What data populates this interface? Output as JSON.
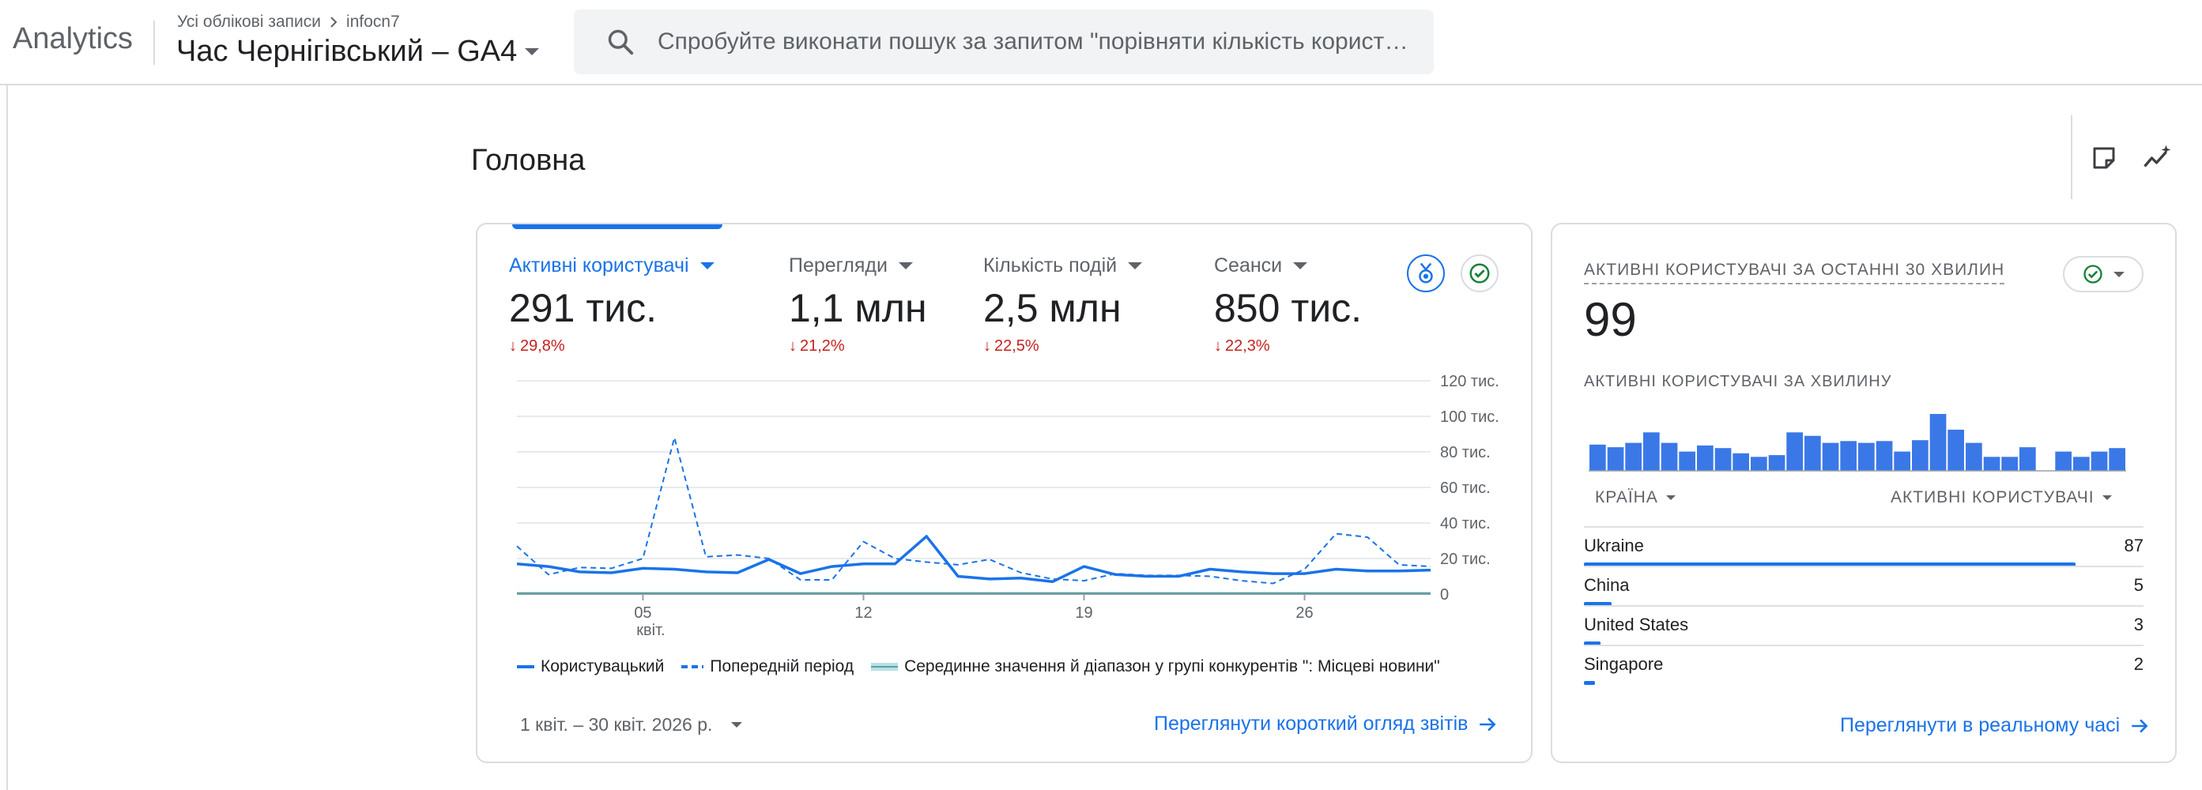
{
  "header": {
    "brand": "Analytics",
    "breadcrumb": {
      "accounts": "Усі облікові записи",
      "account": "infocn7"
    },
    "property": "Час Чернігівський – GA4",
    "search_placeholder": "Спробуйте виконати пошук за запитом \"порівняти кількість користувачів"
  },
  "page": {
    "title": "Головна"
  },
  "main_card": {
    "metrics": [
      {
        "label": "Активні користувачі",
        "value": "291 тис.",
        "change": "29,8%",
        "active": true
      },
      {
        "label": "Перегляди",
        "value": "1,1 млн",
        "change": "21,2%",
        "active": false
      },
      {
        "label": "Кількість подій",
        "value": "2,5 млн",
        "change": "22,5%",
        "active": false
      },
      {
        "label": "Сеанси",
        "value": "850 тис.",
        "change": "22,3%",
        "active": false
      }
    ],
    "legend": {
      "current": "Користувацький",
      "previous": "Попередній період",
      "benchmark": "Серединне значення й діапазон у групі конкурентів \": Місцеві новини\""
    },
    "date_range": "1 квіт. – 30 квіт. 2026 р.",
    "link": "Переглянути короткий огляд звітів"
  },
  "chart_data": {
    "type": "line",
    "x": [
      "1 квіт.",
      "2",
      "3",
      "4",
      "5",
      "6",
      "7",
      "8",
      "9",
      "10",
      "11",
      "12",
      "13",
      "14",
      "15",
      "16",
      "17",
      "18",
      "19",
      "20",
      "21",
      "22",
      "23",
      "24",
      "25",
      "26",
      "27",
      "28",
      "29",
      "30"
    ],
    "x_tick_labels": [
      {
        "label": "05",
        "sub": "квіт.",
        "index": 4
      },
      {
        "label": "12",
        "sub": "",
        "index": 11
      },
      {
        "label": "19",
        "sub": "",
        "index": 18
      },
      {
        "label": "26",
        "sub": "",
        "index": 25
      }
    ],
    "y_ticks": [
      "0",
      "20 тис.",
      "40 тис.",
      "60 тис.",
      "80 тис.",
      "100 тис.",
      "120 тис."
    ],
    "ylim": [
      0,
      120000
    ],
    "series": [
      {
        "name": "Користувацький",
        "color": "#1a73e8",
        "style": "solid",
        "values": [
          17000,
          15500,
          12500,
          12000,
          14500,
          14000,
          12500,
          12000,
          19500,
          11500,
          15500,
          17000,
          17000,
          32500,
          10000,
          8500,
          9000,
          7000,
          15500,
          11000,
          10000,
          10000,
          14000,
          12500,
          11500,
          11500,
          14000,
          13000,
          13000,
          13500
        ]
      },
      {
        "name": "Попередній період",
        "color": "#1a73e8",
        "style": "dashed",
        "values": [
          27000,
          11000,
          15000,
          14500,
          20000,
          88000,
          21000,
          22000,
          20000,
          8000,
          8000,
          29500,
          20000,
          18000,
          16500,
          19500,
          12000,
          8500,
          7500,
          11500,
          10500,
          10500,
          10000,
          7500,
          6000,
          14000,
          34000,
          32000,
          16500,
          15500
        ]
      }
    ]
  },
  "realtime": {
    "title": "АКТИВНІ КОРИСТУВАЧІ ЗА ОСТАННІ 30 ХВИЛИН",
    "value": "99",
    "subtitle": "АКТИВНІ КОРИСТУВАЧІ ЗА ХВИЛИНУ",
    "per_minute": [
      3,
      2.7,
      3.2,
      4.4,
      3.2,
      2.2,
      2.9,
      2.6,
      2.0,
      1.6,
      1.8,
      4.4,
      4.0,
      3.2,
      3.4,
      3.2,
      3.4,
      2.2,
      3.5,
      6.5,
      4.7,
      3.2,
      1.6,
      1.6,
      2.7,
      0,
      2.2,
      1.6,
      2.2,
      2.6
    ],
    "columns": {
      "country": "КРАЇНА",
      "users": "АКТИВНІ КОРИСТУВАЧІ"
    },
    "rows": [
      {
        "country": "Ukraine",
        "value": "87",
        "fraction": 0.879
      },
      {
        "country": "China",
        "value": "5",
        "fraction": 0.05
      },
      {
        "country": "United States",
        "value": "3",
        "fraction": 0.03
      },
      {
        "country": "Singapore",
        "value": "2",
        "fraction": 0.02
      }
    ],
    "link": "Переглянути в реальному часі"
  }
}
